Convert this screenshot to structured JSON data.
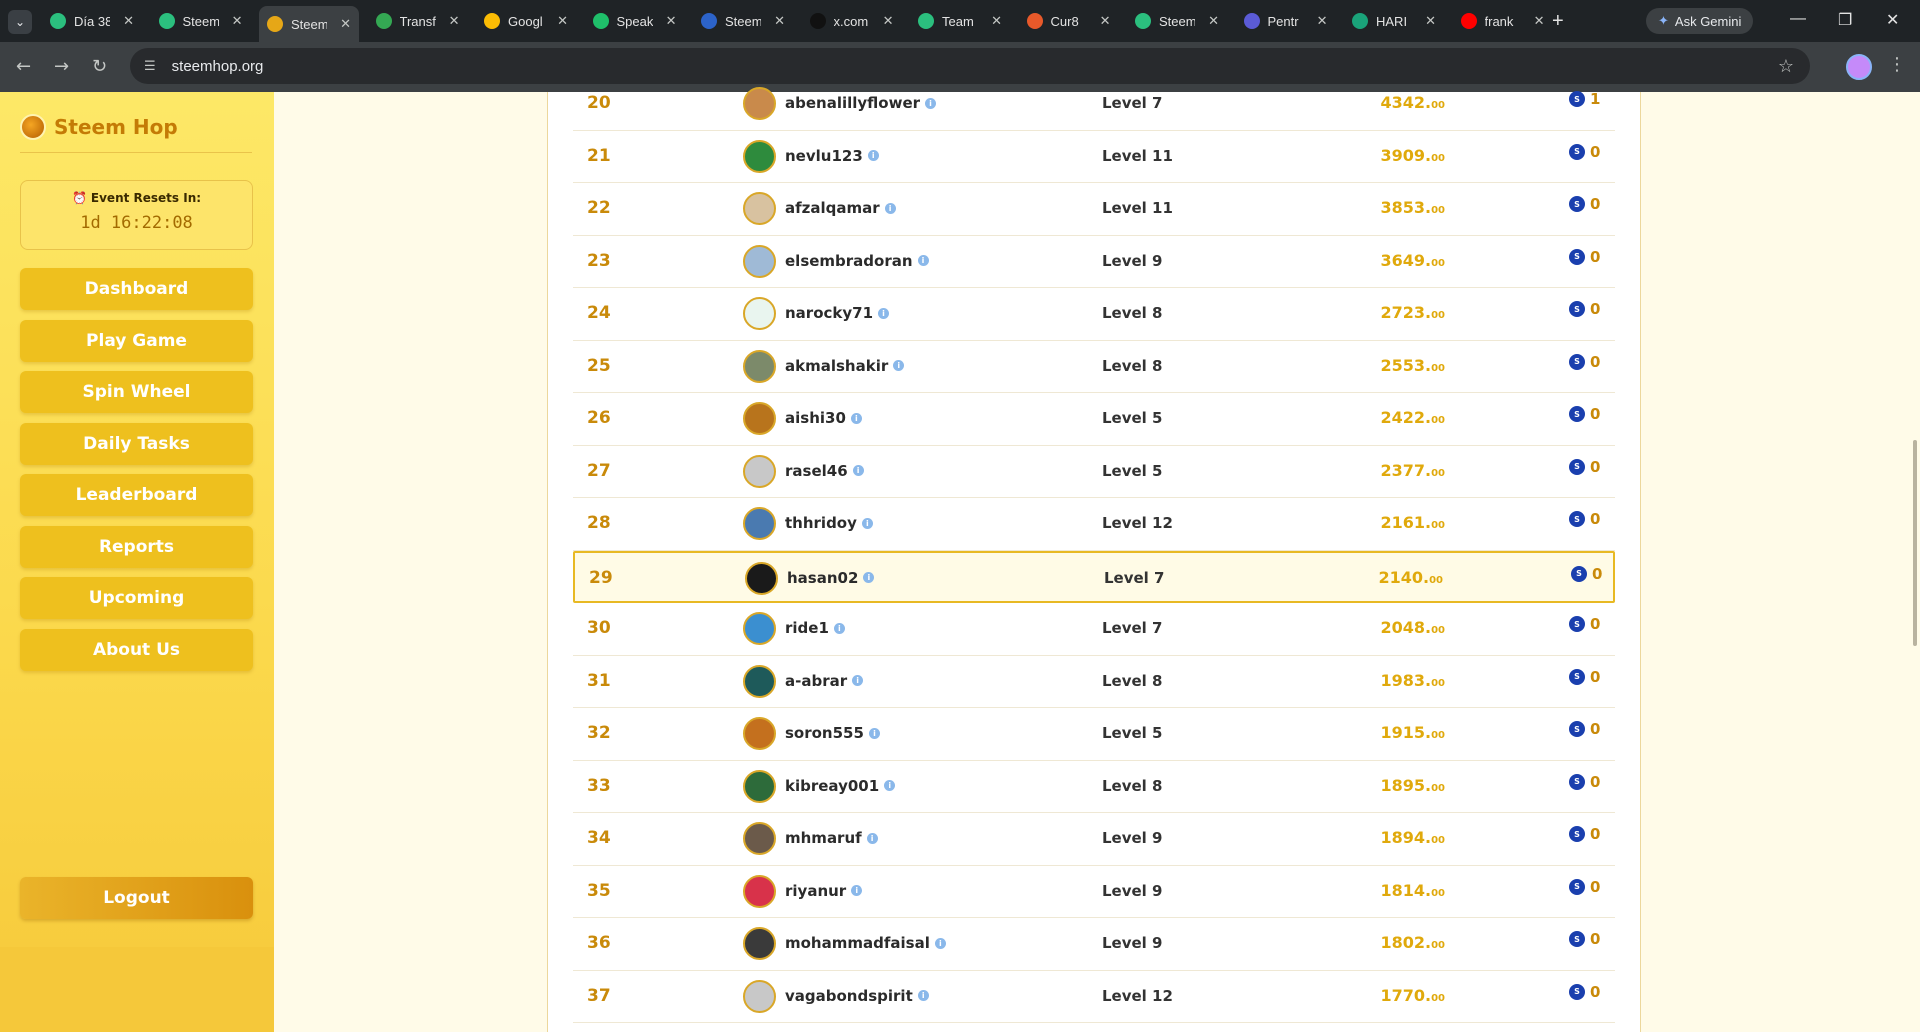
{
  "browser": {
    "tabs": [
      {
        "title": "Día 38",
        "color": "#2bbf7e",
        "active": false
      },
      {
        "title": "Steem",
        "color": "#2bbf7e",
        "active": false
      },
      {
        "title": "Steem",
        "color": "#e6a717",
        "active": true
      },
      {
        "title": "Transf",
        "color": "#34a853",
        "active": false
      },
      {
        "title": "Googl",
        "color": "#fbbc04",
        "active": false
      },
      {
        "title": "Speak",
        "color": "#1fbf6a",
        "active": false
      },
      {
        "title": "Steem",
        "color": "#2c63c9",
        "active": false
      },
      {
        "title": "x.com",
        "color": "#111111",
        "active": false
      },
      {
        "title": "Team",
        "color": "#2bbf7e",
        "active": false
      },
      {
        "title": "Cur8",
        "color": "#e8592a",
        "active": false
      },
      {
        "title": "Steem",
        "color": "#2bbf7e",
        "active": false
      },
      {
        "title": "Pentr",
        "color": "#5b5bd6",
        "active": false
      },
      {
        "title": "HARI",
        "color": "#1aa37a",
        "active": false
      },
      {
        "title": "frank",
        "color": "#ff0000",
        "active": false
      }
    ],
    "ask_gemini_label": "Ask Gemini",
    "url": "steemhop.org"
  },
  "sidebar": {
    "brand": "Steem Hop",
    "timer_label": "Event Resets In:",
    "timer_value": "1d 16:22:08",
    "nav": [
      "Dashboard",
      "Play Game",
      "Spin Wheel",
      "Daily Tasks",
      "Leaderboard",
      "Reports",
      "Upcoming",
      "About Us"
    ],
    "logout_label": "Logout"
  },
  "leaderboard": {
    "rows": [
      {
        "rank": "20",
        "user": "abenalillyflower",
        "level": "Level 7",
        "score": "4342.",
        "decimals": "00",
        "reward": "1",
        "avatar_color": "#c98a4b",
        "highlight": false
      },
      {
        "rank": "21",
        "user": "nevlu123",
        "level": "Level 11",
        "score": "3909.",
        "decimals": "00",
        "reward": "0",
        "avatar_color": "#2e8b3d",
        "highlight": false
      },
      {
        "rank": "22",
        "user": "afzalqamar",
        "level": "Level 11",
        "score": "3853.",
        "decimals": "00",
        "reward": "0",
        "avatar_color": "#d8c2a0",
        "highlight": false
      },
      {
        "rank": "23",
        "user": "elsembradoran",
        "level": "Level 9",
        "score": "3649.",
        "decimals": "00",
        "reward": "0",
        "avatar_color": "#9fbad6",
        "highlight": false
      },
      {
        "rank": "24",
        "user": "narocky71",
        "level": "Level 8",
        "score": "2723.",
        "decimals": "00",
        "reward": "0",
        "avatar_color": "#e9f5ef",
        "highlight": false
      },
      {
        "rank": "25",
        "user": "akmalshakir",
        "level": "Level 8",
        "score": "2553.",
        "decimals": "00",
        "reward": "0",
        "avatar_color": "#7c8a6a",
        "highlight": false
      },
      {
        "rank": "26",
        "user": "aishi30",
        "level": "Level 5",
        "score": "2422.",
        "decimals": "00",
        "reward": "0",
        "avatar_color": "#b8741c",
        "highlight": false
      },
      {
        "rank": "27",
        "user": "rasel46",
        "level": "Level 5",
        "score": "2377.",
        "decimals": "00",
        "reward": "0",
        "avatar_color": "#c8c8c8",
        "highlight": false
      },
      {
        "rank": "28",
        "user": "thhridoy",
        "level": "Level 12",
        "score": "2161.",
        "decimals": "00",
        "reward": "0",
        "avatar_color": "#4a7ab0",
        "highlight": false
      },
      {
        "rank": "29",
        "user": "hasan02",
        "level": "Level 7",
        "score": "2140.",
        "decimals": "00",
        "reward": "0",
        "avatar_color": "#1a1a1a",
        "highlight": true
      },
      {
        "rank": "30",
        "user": "ride1",
        "level": "Level 7",
        "score": "2048.",
        "decimals": "00",
        "reward": "0",
        "avatar_color": "#3b8fd0",
        "highlight": false
      },
      {
        "rank": "31",
        "user": "a-abrar",
        "level": "Level 8",
        "score": "1983.",
        "decimals": "00",
        "reward": "0",
        "avatar_color": "#1e5a5a",
        "highlight": false
      },
      {
        "rank": "32",
        "user": "soron555",
        "level": "Level 5",
        "score": "1915.",
        "decimals": "00",
        "reward": "0",
        "avatar_color": "#c4701e",
        "highlight": false
      },
      {
        "rank": "33",
        "user": "kibreay001",
        "level": "Level 8",
        "score": "1895.",
        "decimals": "00",
        "reward": "0",
        "avatar_color": "#2d6b3a",
        "highlight": false
      },
      {
        "rank": "34",
        "user": "mhmaruf",
        "level": "Level 9",
        "score": "1894.",
        "decimals": "00",
        "reward": "0",
        "avatar_color": "#6b5a4a",
        "highlight": false
      },
      {
        "rank": "35",
        "user": "riyanur",
        "level": "Level 9",
        "score": "1814.",
        "decimals": "00",
        "reward": "0",
        "avatar_color": "#d8324a",
        "highlight": false
      },
      {
        "rank": "36",
        "user": "mohammadfaisal",
        "level": "Level 9",
        "score": "1802.",
        "decimals": "00",
        "reward": "0",
        "avatar_color": "#3a3a3a",
        "highlight": false
      },
      {
        "rank": "37",
        "user": "vagabondspirit",
        "level": "Level 12",
        "score": "1770.",
        "decimals": "00",
        "reward": "0",
        "avatar_color": "#c8c8c8",
        "highlight": false
      }
    ]
  }
}
